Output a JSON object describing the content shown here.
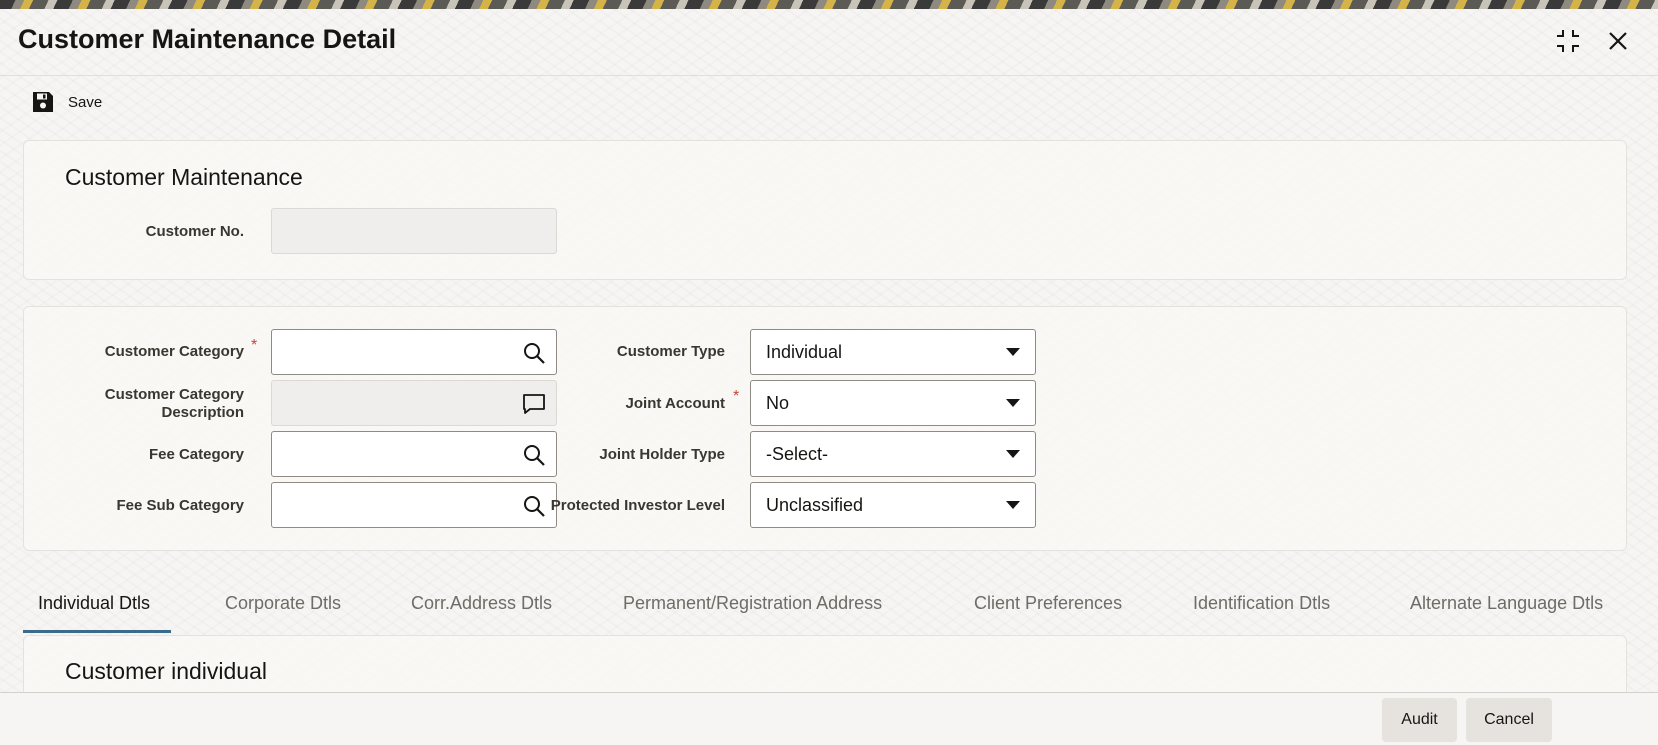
{
  "window": {
    "title": "Customer Maintenance Detail",
    "icons": {
      "minimize": "collapse-icon",
      "close": "close-icon"
    }
  },
  "toolbar": {
    "save_label": "Save",
    "save_icon": "floppy-disk-icon"
  },
  "section1": {
    "title": "Customer Maintenance",
    "customer_no_label": "Customer No.",
    "customer_no_value": ""
  },
  "section2": {
    "customer_category_label": "Customer Category",
    "customer_category_value": "",
    "customer_category_desc_label_line1": "Customer Category",
    "customer_category_desc_label_line2": "Description",
    "customer_category_desc_value": "",
    "fee_category_label": "Fee Category",
    "fee_category_value": "",
    "fee_sub_category_label": "Fee Sub Category",
    "fee_sub_category_value": "",
    "customer_type_label": "Customer Type",
    "customer_type_value": "Individual",
    "joint_account_label": "Joint Account",
    "joint_account_value": "No",
    "joint_holder_type_label": "Joint Holder Type",
    "joint_holder_type_value": "-Select-",
    "protected_investor_level_label": "Protected Investor Level",
    "protected_investor_level_value": "Unclassified",
    "required_marker": "*"
  },
  "tabs": [
    {
      "label": "Individual Dtls",
      "active": true
    },
    {
      "label": "Corporate Dtls",
      "active": false
    },
    {
      "label": "Corr.Address Dtls",
      "active": false
    },
    {
      "label": "Permanent/Registration Address",
      "active": false
    },
    {
      "label": "Client Preferences",
      "active": false
    },
    {
      "label": "Identification Dtls",
      "active": false
    },
    {
      "label": "Alternate Language Dtls",
      "active": false
    }
  ],
  "section3": {
    "title": "Customer individual"
  },
  "footer": {
    "audit_label": "Audit",
    "cancel_label": "Cancel"
  },
  "colors": {
    "accent": "#3c6a8a",
    "required": "#c74634",
    "text": "#161513"
  }
}
